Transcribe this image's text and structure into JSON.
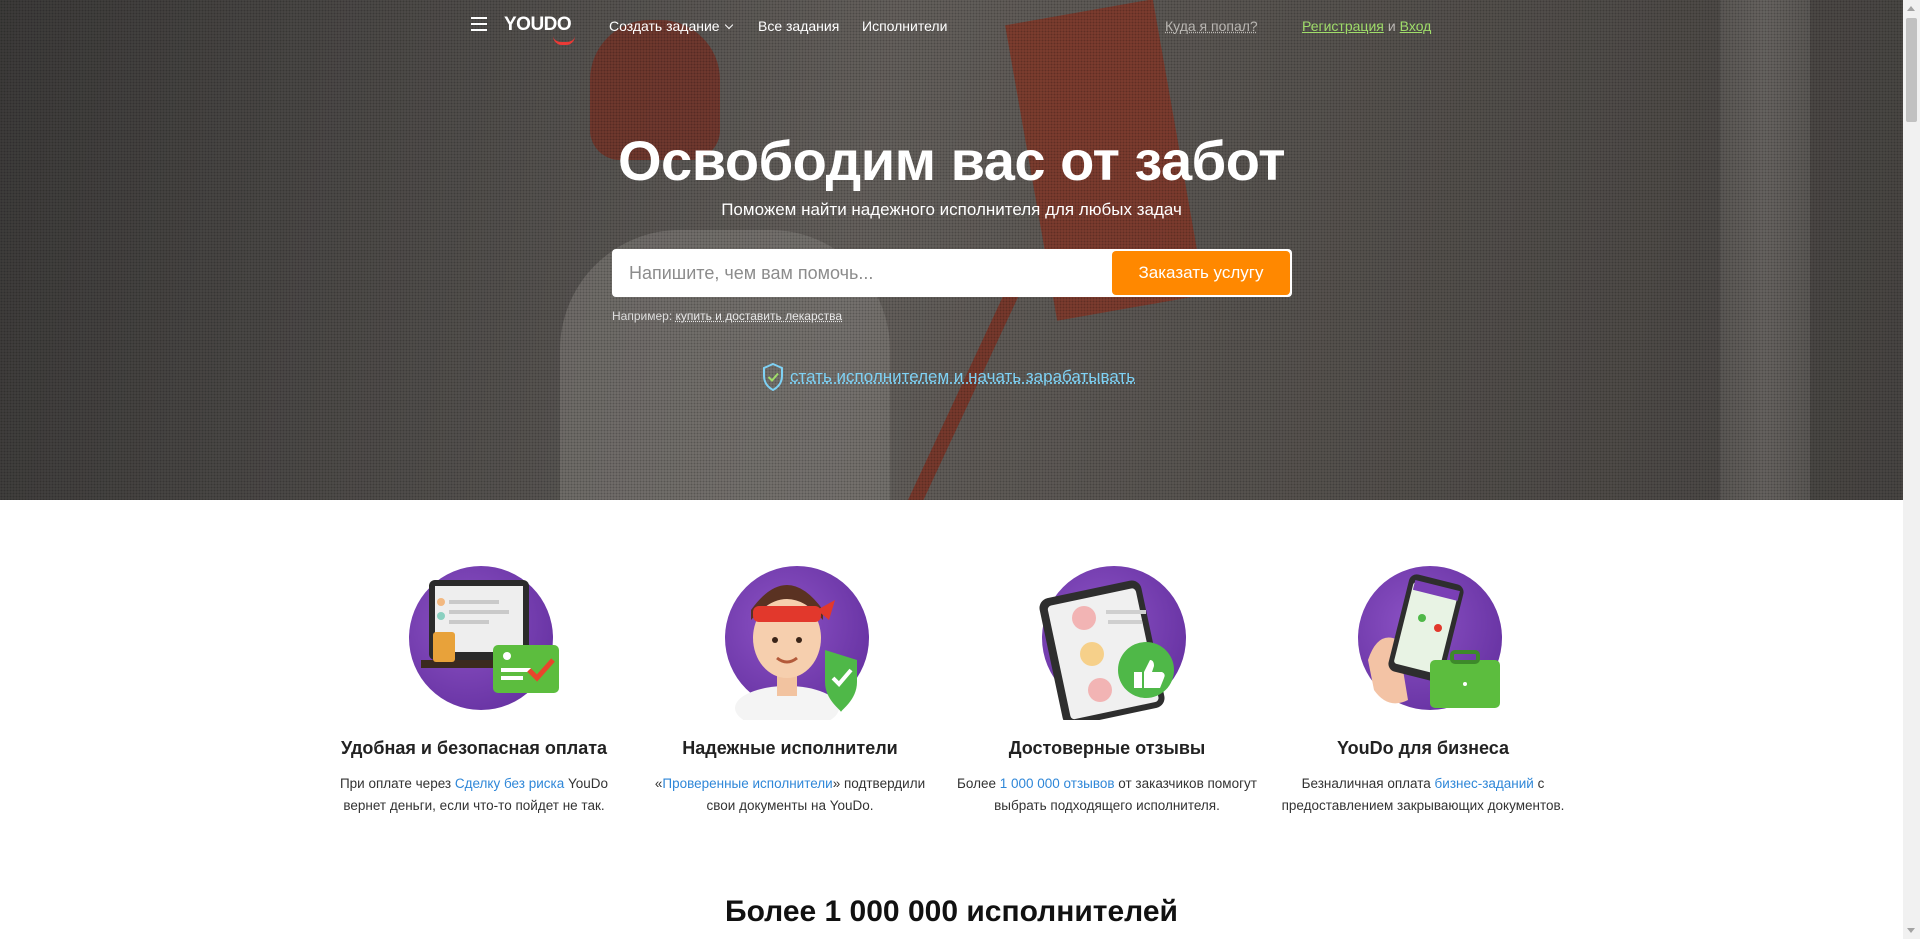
{
  "header": {
    "logo_text": "YOUDO",
    "nav": [
      {
        "label": "Создать задание"
      },
      {
        "label": "Все задания"
      },
      {
        "label": "Исполнители"
      }
    ],
    "where_link": "Куда я попал?",
    "register_link": "Регистрация",
    "and_text": "и",
    "login_link": "Вход"
  },
  "hero": {
    "title": "Освободим вас от забот",
    "subtitle": "Поможем найти надежного исполнителя для любых задач",
    "search_placeholder": "Напишите, чем вам помочь...",
    "order_button": "Заказать услугу",
    "example_prefix": "Например:",
    "example_link": "купить и доставить лекарства",
    "become_link": "стать исполнителем и начать зарабатывать"
  },
  "features": [
    {
      "title": "Удобная и безопасная оплата",
      "text_before": "При оплате через ",
      "link": "Сделку без риска",
      "text_after": " YouDo вернет деньги, если что-то пойдет не так."
    },
    {
      "title": "Надежные исполнители",
      "text_before": "«",
      "link": "Проверенные исполнители",
      "text_after": "» подтвердили свои документы на YouDo."
    },
    {
      "title": "Достоверные отзывы",
      "text_before": "Более ",
      "link": "1 000 000 отзывов",
      "text_after": " от заказчиков помогут выбрать подходящего исполнителя."
    },
    {
      "title": "YouDo для бизнеса",
      "text_before": "Безналичная оплата ",
      "link": "бизнес-заданий",
      "text_after": " с предоставлением закрывающих документов."
    }
  ],
  "bottom": {
    "title": "Более 1 000 000 исполнителей"
  },
  "colors": {
    "accent_orange": "#ff8800",
    "link_green": "#9fdc6a",
    "link_blue": "#2f87d8",
    "illustration_purple": "#6a33a8"
  },
  "icons": [
    "menu-icon",
    "chevron-down-icon",
    "shield-check-icon",
    "card-check-icon",
    "worker-shield-icon",
    "thumbs-up-icon",
    "briefcase-icon"
  ]
}
